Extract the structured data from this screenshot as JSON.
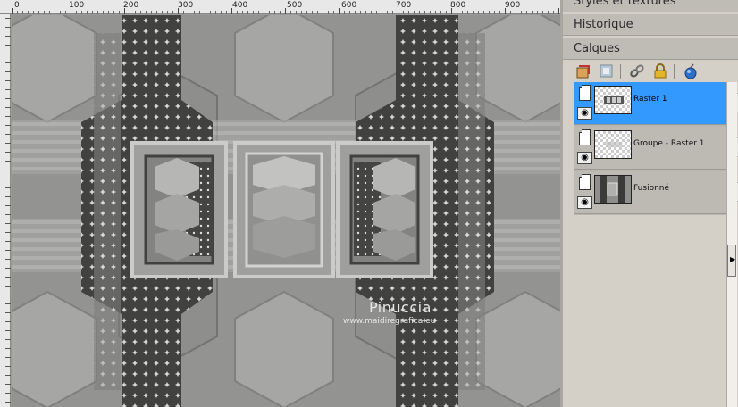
{
  "ruler": {
    "labels": [
      "0",
      "100",
      "200",
      "300",
      "400",
      "500",
      "600",
      "700",
      "800",
      "900"
    ]
  },
  "canvas": {
    "watermark_name": "Pinuccia",
    "watermark_url": "www.maidiregrafica.eu"
  },
  "panels": {
    "styles_title": "Styles et textures",
    "historique_title": "Historique",
    "calques_title": "Calques"
  },
  "layers": [
    {
      "name": "Raster 1",
      "selected": true
    },
    {
      "name": "Groupe - Raster 1",
      "selected": false
    },
    {
      "name": "Fusionné",
      "selected": false
    }
  ],
  "toolbar_icons": [
    "new-layer-icon",
    "mask-icon",
    "link-icon",
    "lock-icon",
    "blend-mode-icon"
  ],
  "colors": {
    "selected_layer": "#3399ff",
    "panel_bg": "#d4d0c8"
  }
}
